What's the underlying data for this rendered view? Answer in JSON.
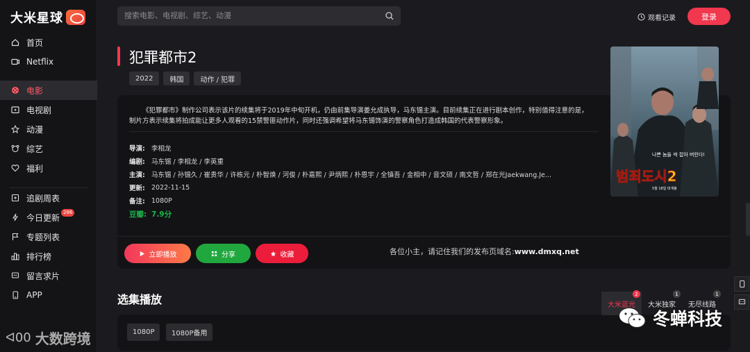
{
  "logo": {
    "text": "大米星球"
  },
  "nav": {
    "group1": [
      {
        "label": "首页",
        "icon": "home-icon"
      },
      {
        "label": "Netflix",
        "icon": "tv-icon"
      }
    ],
    "group2": [
      {
        "label": "电影",
        "icon": "film-reel-icon",
        "active": true
      },
      {
        "label": "电视剧",
        "icon": "tv-play-icon"
      },
      {
        "label": "动漫",
        "icon": "star-icon"
      },
      {
        "label": "综艺",
        "icon": "bear-icon"
      },
      {
        "label": "福利",
        "icon": "heart-icon"
      }
    ],
    "group3": [
      {
        "label": "追剧周表",
        "icon": "calendar-icon"
      },
      {
        "label": "今日更新",
        "icon": "lightning-icon",
        "badge": "286"
      },
      {
        "label": "专题列表",
        "icon": "flag-icon"
      },
      {
        "label": "排行榜",
        "icon": "ranking-icon"
      },
      {
        "label": "留言求片",
        "icon": "message-icon"
      },
      {
        "label": "APP",
        "icon": "phone-icon"
      }
    ]
  },
  "watermark": {
    "mark": "ᐊ00",
    "text": "大数跨境"
  },
  "search": {
    "placeholder": "搜索电影、电视剧、综艺、动漫"
  },
  "header": {
    "history": "观看记录",
    "login": "登录"
  },
  "movie": {
    "title": "犯罪都市2",
    "tags": [
      "2022",
      "韩国",
      "动作 /  犯罪"
    ],
    "description": "《犯罪都市》制作公司表示该片的续集将于2019年中旬开机，仍由前集导演姜允成执导，马东锡主演。目前续集正在进行剧本创作，特别值得注意的是，制片方表示续集将拍成能让更多人观看的15禁警匪动作片，同时还强调希望将马东锡饰演的警察角色打造成韩国的代表警察形象。",
    "meta": [
      {
        "k": "导演:",
        "v": "李相龙"
      },
      {
        "k": "编剧:",
        "v": "马东锡 / 李相龙 / 李英重"
      },
      {
        "k": "主演:",
        "v": "马东锡 / 孙锡久 / 崔贵华 / 许栋元 / 朴智焕 / 河俊 / 朴嘉熙 / 尹炳熙 / 朴恩宇 / 全镇吾 / 金相中 / 音文硕 / 南文哲 / 郑在光Jaekwang.Je..."
      },
      {
        "k": "更新:",
        "v": "2022-11-15"
      },
      {
        "k": "备注:",
        "v": "1080P"
      }
    ],
    "score": {
      "k": "豆瓣:",
      "v": "7.9分"
    },
    "poster_text": {
      "korean": "범죄도시2",
      "sub": "나쁜 놈들 싹 잡아 버린다!",
      "date": "5월 18일 대개봉"
    }
  },
  "actions": {
    "play": "立即播放",
    "share": "分享",
    "favorite": "收藏"
  },
  "notice": {
    "prefix": "各位小主，请记住我们的发布页域名:",
    "domain": "www.dmxq.net"
  },
  "episodes": {
    "title": "选集播放",
    "items": [
      "1080P",
      "1080P备用"
    ]
  },
  "sources": [
    {
      "label": "大米蓝光",
      "count": "2",
      "active": true
    },
    {
      "label": "大米独家",
      "count": "1"
    },
    {
      "label": "无尽线路",
      "count": "1"
    }
  ],
  "overlay": {
    "text": "冬蝉科技"
  },
  "colors": {
    "accent": "#f2384e",
    "share": "#20a83e",
    "score": "#18b54a",
    "bg": "#1b1b1f"
  }
}
